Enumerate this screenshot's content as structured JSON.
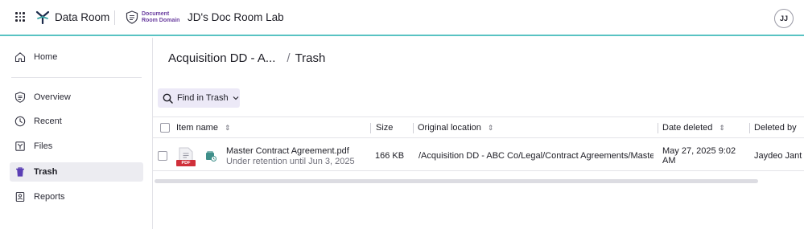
{
  "header": {
    "app_name": "Data Room",
    "domain_logo_line1": "Document",
    "domain_logo_line2": "Room Domain",
    "room_title": "JD's Doc Room Lab",
    "avatar_initials": "JJ",
    "accent_color": "#59c3c3"
  },
  "sidebar": {
    "items": [
      {
        "label": "Home",
        "icon": "home-icon"
      },
      {
        "label": "Overview",
        "icon": "overview-icon"
      },
      {
        "label": "Recent",
        "icon": "clock-icon"
      },
      {
        "label": "Files",
        "icon": "files-icon"
      },
      {
        "label": "Trash",
        "icon": "trash-icon",
        "active": true
      },
      {
        "label": "Reports",
        "icon": "reports-icon"
      }
    ]
  },
  "breadcrumb": {
    "parent": "Acquisition DD - A...",
    "separator": "/",
    "current": "Trash"
  },
  "toolbar": {
    "find_label": "Find in Trash"
  },
  "table": {
    "columns": [
      "Item name",
      "Size",
      "Original location",
      "Date deleted",
      "Deleted by"
    ],
    "rows": [
      {
        "name": "Master Contract Agreement.pdf",
        "retention": "Under retention until Jun 3, 2025",
        "file_type": "PDF",
        "size": "166 KB",
        "location": "/Acquisition DD - ABC Co/Legal/Contract Agreements/Maste...",
        "date_line1": "May 27, 2025 9:02",
        "date_line2": "AM",
        "deleted_by": "Jaydeo Jant"
      }
    ]
  }
}
